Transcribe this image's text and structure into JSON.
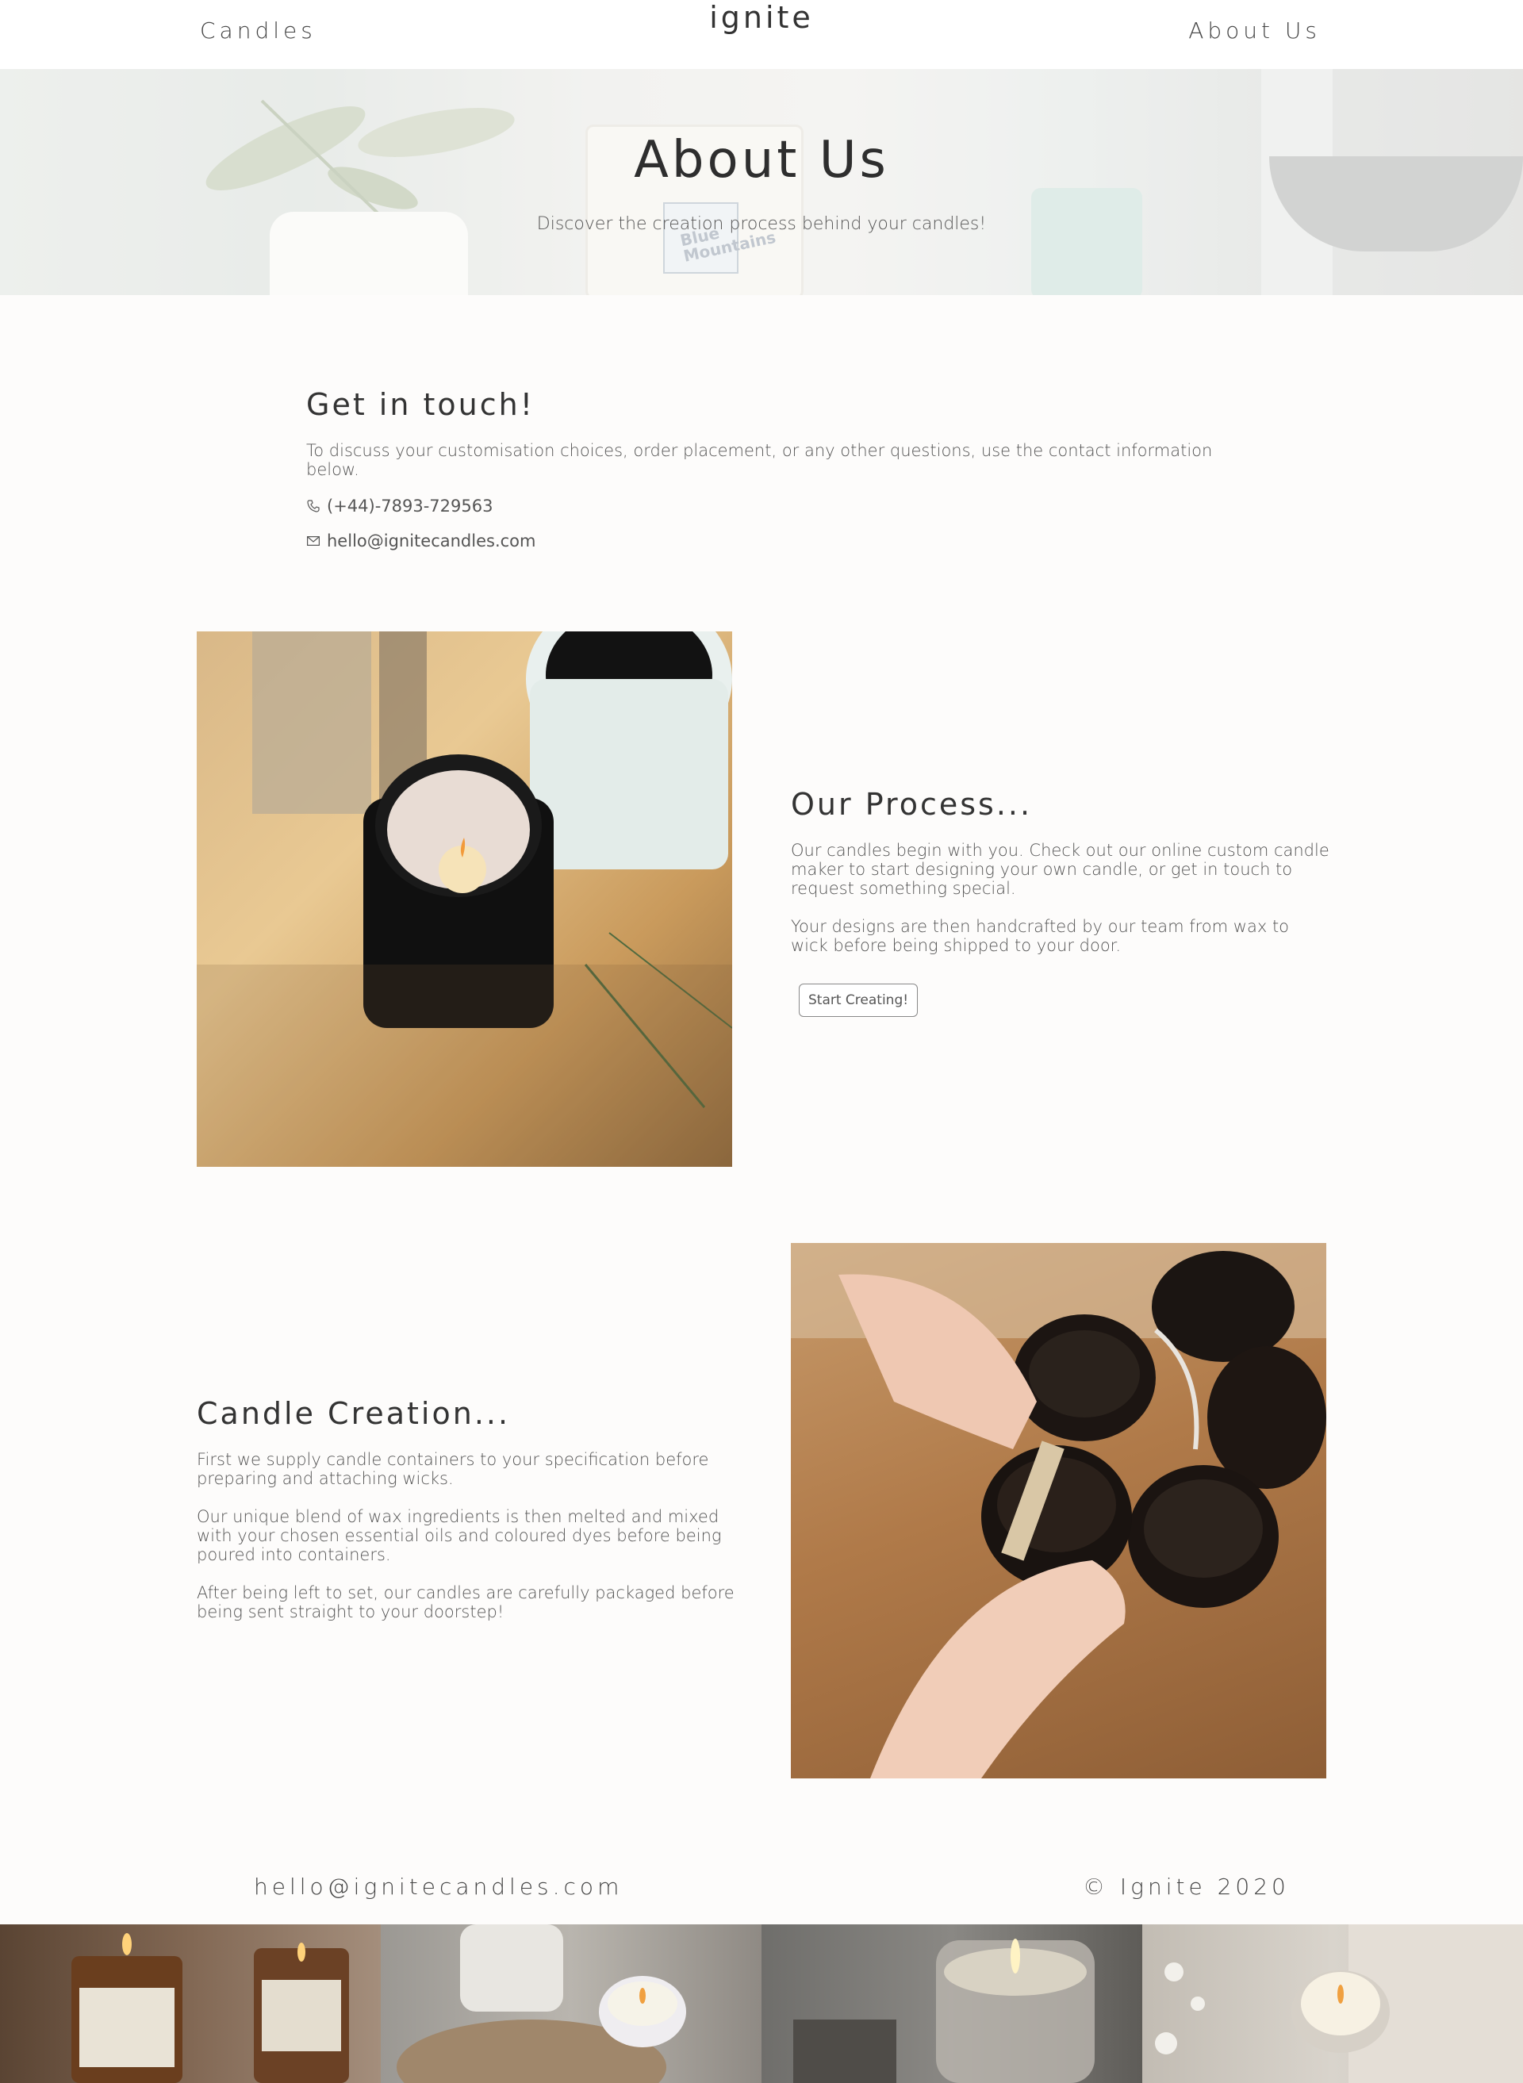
{
  "nav": {
    "left_link": "Candles",
    "brand": "ignite",
    "right_link": "About Us"
  },
  "hero": {
    "title": "About Us",
    "subtitle": "Discover the creation process behind your candles!",
    "image_label": "Blue Mountains"
  },
  "contact": {
    "heading": "Get in touch!",
    "lead": "To discuss your customisation choices, order placement, or any other questions, use the contact information below.",
    "phone": "(+44)-7893-729563",
    "email": "hello@ignitecandles.com",
    "phone_icon": "phone-icon",
    "email_icon": "envelope-icon"
  },
  "process": {
    "heading": "Our Process...",
    "para1": "Our candles begin with you. Check out our online custom candle maker to start designing your own candle, or get in touch to request something special.",
    "para2": "Your designs are then handcrafted by our team from wax to wick before being shipped to your door.",
    "button": "Start Creating!"
  },
  "creation": {
    "heading": "Candle Creation...",
    "para1": "First we supply candle containers to your specification before preparing and attaching wicks.",
    "para2": "Our unique blend of wax ingredients is then melted and mixed with your chosen essential oils and coloured dyes before being poured into containers.",
    "para3": "After being left to set, our candles are carefully packaged before being sent straight to your doorstep!"
  },
  "footer": {
    "email": "hello@ignitecandles.com",
    "copyright": "© Ignite 2020"
  }
}
